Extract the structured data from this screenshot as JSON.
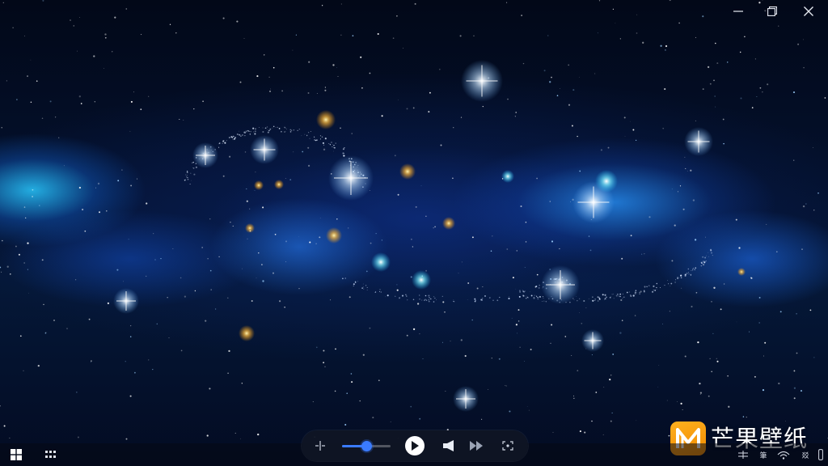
{
  "window": {
    "controls": {
      "minimize_icon": "minimize-icon",
      "maximize_icon": "restore-icon",
      "close_icon": "close-icon"
    }
  },
  "player": {
    "icons": [
      "playlist-add-icon",
      "volume-slider",
      "play-icon",
      "speaker-icon",
      "fast-forward-icon",
      "screenshot-icon"
    ],
    "volume_level": 0.5,
    "accent": "#3a7bff"
  },
  "watermark": {
    "logo_glyph": "M",
    "text": "芒果壁纸",
    "logo_color": "#f59a0d"
  },
  "taskbar": {
    "start_icon": "windows-logo-icon",
    "tray_items": [
      "keyboard-icon",
      "input-method-icon",
      "network-icon",
      "notification-icon"
    ],
    "tray_labels": [
      "筆",
      "睡",
      "㸚"
    ]
  },
  "colors": {
    "nebula": "#2a8cff",
    "nebula_cyan": "#28c8ff",
    "sky": "#041230"
  }
}
